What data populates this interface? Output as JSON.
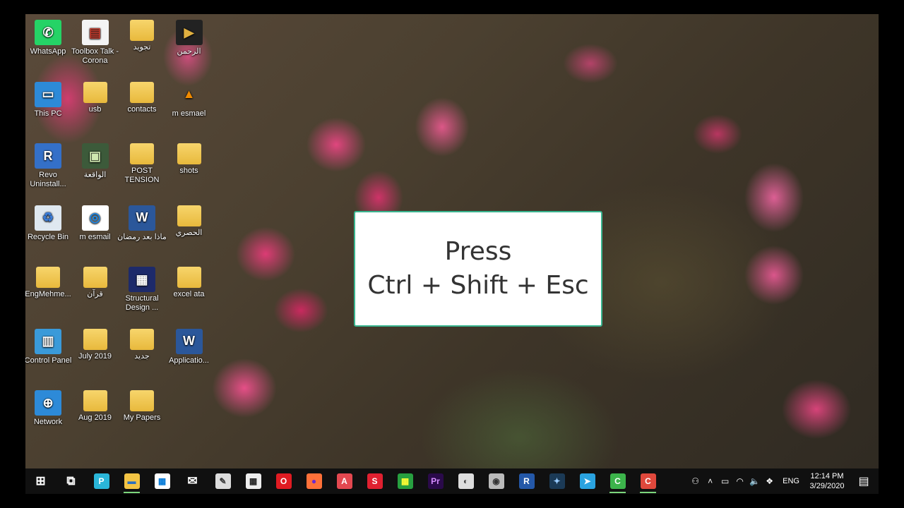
{
  "desktop": {
    "icons": [
      {
        "label": "WhatsApp",
        "glyph": "✆",
        "bg": "#25d366",
        "fg": "#fff"
      },
      {
        "label": "Toolbox Talk - Corona",
        "glyph": "▤",
        "bg": "#f4f4f4",
        "fg": "#c0392b"
      },
      {
        "label": "تجويد",
        "glyph": "",
        "bg": "folder",
        "fg": "#fff"
      },
      {
        "label": "الرحمن",
        "glyph": "▶",
        "bg": "#222",
        "fg": "#e0b040"
      },
      {
        "label": "This PC",
        "glyph": "▭",
        "bg": "#2d8ad8",
        "fg": "#fff"
      },
      {
        "label": "usb",
        "glyph": "",
        "bg": "folder",
        "fg": "#fff"
      },
      {
        "label": "contacts",
        "glyph": "",
        "bg": "folder",
        "fg": "#fff"
      },
      {
        "label": "m esmael",
        "glyph": "▲",
        "bg": "transparent",
        "fg": "#f08a00"
      },
      {
        "label": "Revo Uninstall...",
        "glyph": "R",
        "bg": "#3470c8",
        "fg": "#fff"
      },
      {
        "label": "الواقعة",
        "glyph": "▣",
        "bg": "#3c5a3a",
        "fg": "#cfe8b0"
      },
      {
        "label": "POST TENSION",
        "glyph": "",
        "bg": "folder",
        "fg": "#fff"
      },
      {
        "label": "shots",
        "glyph": "",
        "bg": "folder",
        "fg": "#fff"
      },
      {
        "label": "Recycle Bin",
        "glyph": "♻",
        "bg": "#dfe8f0",
        "fg": "#3a7bd5"
      },
      {
        "label": "m esmail",
        "glyph": "◎",
        "bg": "#fff",
        "fg": "#1e88e5"
      },
      {
        "label": "ماذا بعد رمضان",
        "glyph": "W",
        "bg": "#2b579a",
        "fg": "#fff"
      },
      {
        "label": "الحصري",
        "glyph": "",
        "bg": "folder",
        "fg": "#fff"
      },
      {
        "label": "EngMehme...",
        "glyph": "",
        "bg": "folder",
        "fg": "#fff"
      },
      {
        "label": "قرآن",
        "glyph": "",
        "bg": "folder",
        "fg": "#fff"
      },
      {
        "label": "Structural Design ...",
        "glyph": "▦",
        "bg": "#1d2a6a",
        "fg": "#fff"
      },
      {
        "label": "excel ata",
        "glyph": "",
        "bg": "folder",
        "fg": "#fff"
      },
      {
        "label": "Control Panel",
        "glyph": "▥",
        "bg": "#3a9ad9",
        "fg": "#fff"
      },
      {
        "label": "July 2019",
        "glyph": "",
        "bg": "folder",
        "fg": "#fff"
      },
      {
        "label": "جديد",
        "glyph": "",
        "bg": "folder",
        "fg": "#fff"
      },
      {
        "label": "Applicatio...",
        "glyph": "W",
        "bg": "#2b579a",
        "fg": "#fff"
      },
      {
        "label": "Network",
        "glyph": "⊕",
        "bg": "#2d8ad8",
        "fg": "#fff"
      },
      {
        "label": "Aug 2019",
        "glyph": "",
        "bg": "folder",
        "fg": "#fff"
      },
      {
        "label": "My Papers",
        "glyph": "",
        "bg": "folder",
        "fg": "#fff"
      }
    ]
  },
  "overlay": {
    "line1": "Press",
    "line2": "Ctrl + Shift + Esc"
  },
  "taskbar": {
    "apps": [
      {
        "name": "start-button",
        "glyph": "⊞",
        "bg": "transparent",
        "fg": "#fff",
        "active": false
      },
      {
        "name": "task-view-button",
        "glyph": "⧉",
        "bg": "transparent",
        "fg": "#fff",
        "active": false
      },
      {
        "name": "pdf-app",
        "glyph": "P",
        "bg": "#2ab6d9",
        "fg": "#fff",
        "active": false
      },
      {
        "name": "file-explorer",
        "glyph": "▬",
        "bg": "#f3c444",
        "fg": "#2a6fbf",
        "active": true
      },
      {
        "name": "store",
        "glyph": "▦",
        "bg": "#fff",
        "fg": "#0078d7",
        "active": false
      },
      {
        "name": "mail",
        "glyph": "✉",
        "bg": "transparent",
        "fg": "#fff",
        "active": false
      },
      {
        "name": "paint",
        "glyph": "✎",
        "bg": "#ddd",
        "fg": "#333",
        "active": false
      },
      {
        "name": "calculator",
        "glyph": "▦",
        "bg": "#eee",
        "fg": "#222",
        "active": false
      },
      {
        "name": "opera",
        "glyph": "O",
        "bg": "#e01b22",
        "fg": "#fff",
        "active": false
      },
      {
        "name": "firefox",
        "glyph": "●",
        "bg": "#ff7139",
        "fg": "#6a2ad0",
        "active": false
      },
      {
        "name": "acrobat",
        "glyph": "A",
        "bg": "#e34850",
        "fg": "#fff",
        "active": false
      },
      {
        "name": "sketchup",
        "glyph": "S",
        "bg": "#e02030",
        "fg": "#fff",
        "active": false
      },
      {
        "name": "excel-grid",
        "glyph": "▦",
        "bg": "#27a040",
        "fg": "#ff3",
        "active": false
      },
      {
        "name": "premiere",
        "glyph": "Pr",
        "bg": "#2a0a4a",
        "fg": "#d48bff",
        "active": false
      },
      {
        "name": "gallery",
        "glyph": "◐",
        "bg": "#ddd",
        "fg": "#444",
        "active": false
      },
      {
        "name": "disk-utility",
        "glyph": "◉",
        "bg": "#bbb",
        "fg": "#333",
        "active": false
      },
      {
        "name": "revit",
        "glyph": "R",
        "bg": "#2458a8",
        "fg": "#fff",
        "active": false
      },
      {
        "name": "media-app",
        "glyph": "✦",
        "bg": "#1b3a56",
        "fg": "#9cf",
        "active": false
      },
      {
        "name": "telegram",
        "glyph": "➤",
        "bg": "#2aa3e0",
        "fg": "#fff",
        "active": false
      },
      {
        "name": "camtasia-green",
        "glyph": "C",
        "bg": "#3cb44b",
        "fg": "#fff",
        "active": true
      },
      {
        "name": "camtasia-red",
        "glyph": "C",
        "bg": "#e0483c",
        "fg": "#fff",
        "active": true
      }
    ]
  },
  "tray": {
    "icons": [
      {
        "name": "people-icon",
        "glyph": "⚇"
      },
      {
        "name": "chevron-up-icon",
        "glyph": "˄"
      },
      {
        "name": "battery-icon",
        "glyph": "▭"
      },
      {
        "name": "wifi-icon",
        "glyph": "◠"
      },
      {
        "name": "volume-icon",
        "glyph": "🔈"
      },
      {
        "name": "dropbox-icon",
        "glyph": "❖"
      }
    ],
    "language": "ENG",
    "time": "12:14 PM",
    "date": "3/29/2020",
    "notification_glyph": "▤"
  }
}
